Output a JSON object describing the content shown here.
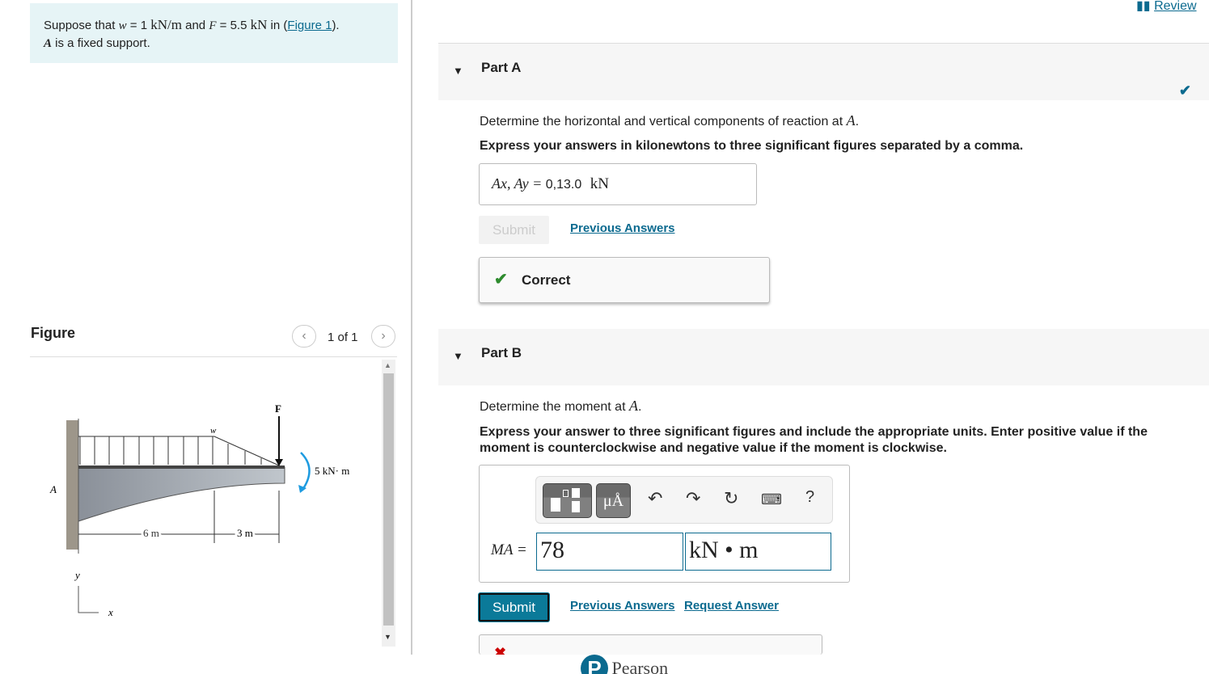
{
  "header": {
    "review_label": "Review"
  },
  "problem": {
    "text_pre": "Suppose that ",
    "w": "w",
    "eq1": " = 1 ",
    "unit1": "kN/m",
    "and": " and ",
    "F": "F",
    "eq2": " = 5.5 ",
    "unit2": "kN",
    "in": " in (",
    "figure_link": "Figure 1",
    "close": ").",
    "line2_var": "A",
    "line2": " is a fixed support."
  },
  "figure": {
    "title": "Figure",
    "pager": "1 of 1",
    "labels": {
      "F": "F",
      "w": "w",
      "moment": "5 kN· m",
      "A": "A",
      "dim1": "6 m",
      "dim2": "3 m",
      "y": "y",
      "x": "x"
    }
  },
  "part_a": {
    "label": "Part A",
    "question": "Determine the horizontal and vertical components of reaction at ",
    "question_var": "A",
    "instruction": "Express your answers in kilonewtons to three significant figures separated by a comma.",
    "answer_label": "Ax, Ay =",
    "answer_value": "0,13.0",
    "answer_unit": "kN",
    "submit": "Submit",
    "previous_answers": "Previous Answers",
    "feedback": "Correct"
  },
  "part_b": {
    "label": "Part B",
    "question": "Determine the moment at ",
    "question_var": "A",
    "instruction": "Express your answer to three significant figures and include the appropriate units. Enter positive value if the moment is counterclockwise and negative value if the moment is clockwise.",
    "answer_label": "MA =",
    "value": "78",
    "unit": "kN • m",
    "toolbar": {
      "units_btn": "μÅ",
      "help": "?"
    },
    "submit": "Submit",
    "previous_answers": "Previous Answers",
    "request_answer": "Request Answer"
  },
  "footer": {
    "brand": "Pearson"
  },
  "colors": {
    "accent": "#0b6a8f",
    "correct": "#2e8b2e",
    "incorrect": "#cc0000"
  }
}
